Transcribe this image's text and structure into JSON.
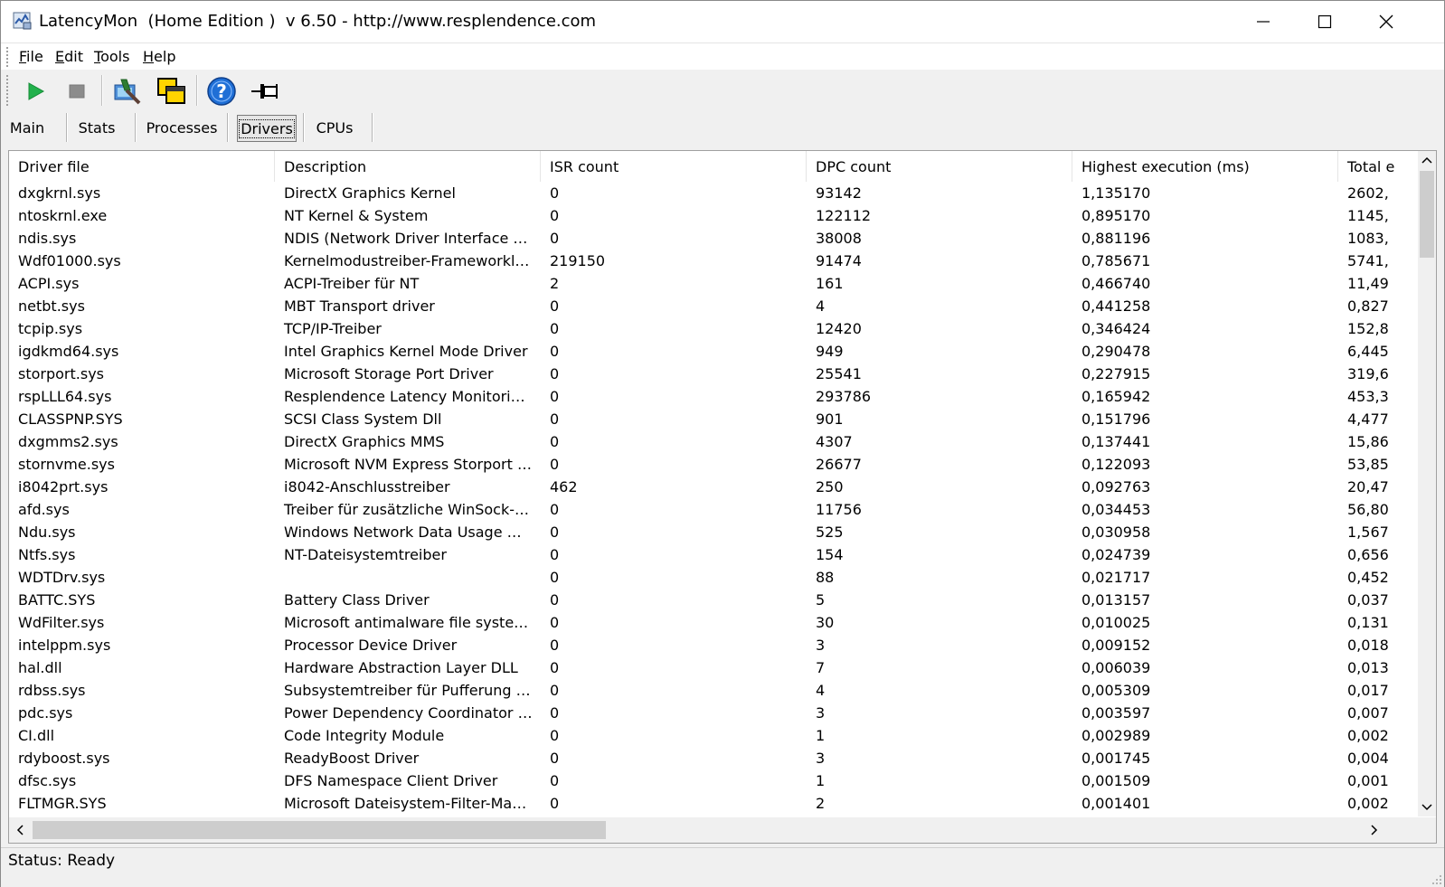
{
  "window": {
    "title": "LatencyMon  (Home Edition )  v 6.50 - http://www.resplendence.com"
  },
  "menu": [
    {
      "label": "File",
      "accel": "F",
      "rest": "ile"
    },
    {
      "label": "Edit",
      "accel": "E",
      "rest": "dit"
    },
    {
      "label": "Tools",
      "accel": "T",
      "rest": "ools"
    },
    {
      "label": "Help",
      "accel": "H",
      "rest": "elp"
    }
  ],
  "toolbar": {
    "icons": [
      "play-icon",
      "stop-icon",
      "analyzer-icon",
      "windows-icon",
      "help-icon",
      "pin-icon"
    ],
    "colors": {
      "play": "#22b14c",
      "stop": "#8c8c8c",
      "help": "#1f6fd6"
    }
  },
  "tabs": [
    {
      "label": "Main",
      "active": false
    },
    {
      "label": "Stats",
      "active": false
    },
    {
      "label": "Processes",
      "active": false
    },
    {
      "label": "Drivers",
      "active": true
    },
    {
      "label": "CPUs",
      "active": false
    }
  ],
  "table": {
    "columns": [
      "Driver file",
      "Description",
      "ISR count",
      "DPC count",
      "Highest execution (ms)",
      "Total e"
    ],
    "rows": [
      [
        "dxgkrnl.sys",
        "DirectX Graphics Kernel",
        "0",
        "93142",
        "1,135170",
        "2602,"
      ],
      [
        "ntoskrnl.exe",
        "NT Kernel & System",
        "0",
        "122112",
        "0,895170",
        "1145,"
      ],
      [
        "ndis.sys",
        "NDIS (Network Driver Interface Spe…",
        "0",
        "38008",
        "0,881196",
        "1083,"
      ],
      [
        "Wdf01000.sys",
        "Kernelmodustreiber-Frameworklaufzeit",
        "219150",
        "91474",
        "0,785671",
        "5741,"
      ],
      [
        "ACPI.sys",
        "ACPI-Treiber für NT",
        "2",
        "161",
        "0,466740",
        "11,49"
      ],
      [
        "netbt.sys",
        "MBT Transport driver",
        "0",
        "4",
        "0,441258",
        "0,827"
      ],
      [
        "tcpip.sys",
        "TCP/IP-Treiber",
        "0",
        "12420",
        "0,346424",
        "152,8"
      ],
      [
        "igdkmd64.sys",
        "Intel Graphics Kernel Mode Driver",
        "0",
        "949",
        "0,290478",
        "6,445"
      ],
      [
        "storport.sys",
        "Microsoft Storage Port Driver",
        "0",
        "25541",
        "0,227915",
        "319,6"
      ],
      [
        "rspLLL64.sys",
        "Resplendence Latency Monitoring a…",
        "0",
        "293786",
        "0,165942",
        "453,3"
      ],
      [
        "CLASSPNP.SYS",
        "SCSI Class System Dll",
        "0",
        "901",
        "0,151796",
        "4,477"
      ],
      [
        "dxgmms2.sys",
        "DirectX Graphics MMS",
        "0",
        "4307",
        "0,137441",
        "15,86"
      ],
      [
        "stornvme.sys",
        "Microsoft NVM Express Storport Mini…",
        "0",
        "26677",
        "0,122093",
        "53,85"
      ],
      [
        "i8042prt.sys",
        "i8042-Anschlusstreiber",
        "462",
        "250",
        "0,092763",
        "20,47"
      ],
      [
        "afd.sys",
        "Treiber für zusätzliche WinSock-Fun…",
        "0",
        "11756",
        "0,034453",
        "56,80"
      ],
      [
        "Ndu.sys",
        "Windows Network Data Usage Monit…",
        "0",
        "525",
        "0,030958",
        "1,567"
      ],
      [
        "Ntfs.sys",
        "NT-Dateisystemtreiber",
        "0",
        "154",
        "0,024739",
        "0,656"
      ],
      [
        "WDTDrv.sys",
        "",
        "0",
        "88",
        "0,021717",
        "0,452"
      ],
      [
        "BATTC.SYS",
        "Battery Class Driver",
        "0",
        "5",
        "0,013157",
        "0,037"
      ],
      [
        "WdFilter.sys",
        "Microsoft antimalware file system filt…",
        "0",
        "30",
        "0,010025",
        "0,131"
      ],
      [
        "intelppm.sys",
        "Processor Device Driver",
        "0",
        "3",
        "0,009152",
        "0,018"
      ],
      [
        "hal.dll",
        "Hardware Abstraction Layer DLL",
        "0",
        "7",
        "0,006039",
        "0,013"
      ],
      [
        "rdbss.sys",
        "Subsystemtreiber für Pufferung des…",
        "0",
        "4",
        "0,005309",
        "0,017"
      ],
      [
        "pdc.sys",
        "Power Dependency Coordinator Driver",
        "0",
        "3",
        "0,003597",
        "0,007"
      ],
      [
        "CI.dll",
        "Code Integrity Module",
        "0",
        "1",
        "0,002989",
        "0,002"
      ],
      [
        "rdyboost.sys",
        "ReadyBoost Driver",
        "0",
        "3",
        "0,001745",
        "0,004"
      ],
      [
        "dfsc.sys",
        "DFS Namespace Client Driver",
        "0",
        "1",
        "0,001509",
        "0,001"
      ],
      [
        "FLTMGR.SYS",
        "Microsoft Dateisystem-Filter-Manager",
        "0",
        "2",
        "0,001401",
        "0,002"
      ]
    ]
  },
  "status": {
    "text": "Status: Ready"
  }
}
